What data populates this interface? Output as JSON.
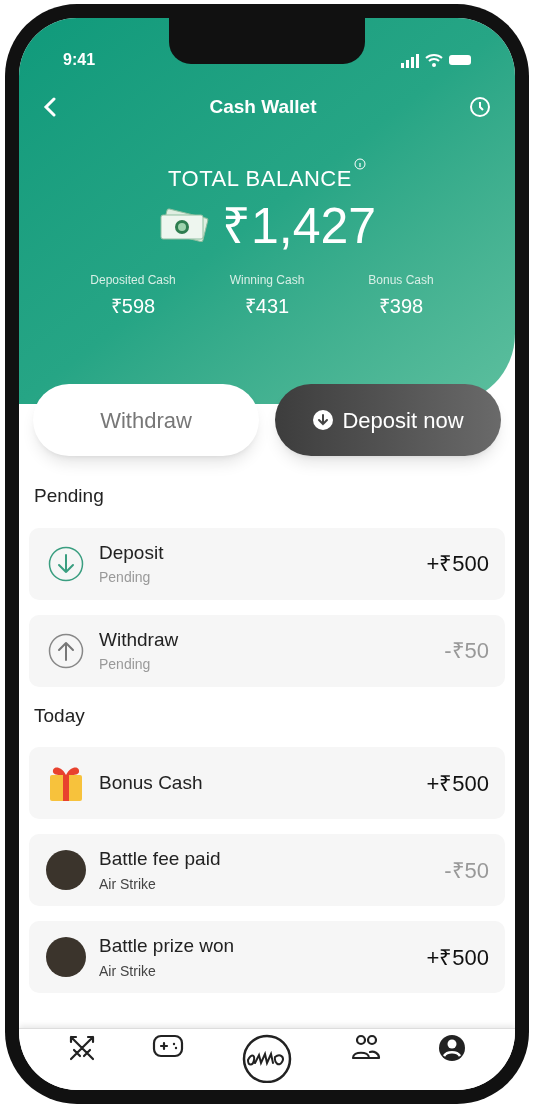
{
  "status_bar": {
    "time": "9:41"
  },
  "header": {
    "title": "Cash Wallet"
  },
  "balance": {
    "label": "TOTAL BALANCE",
    "amount": "₹1,427",
    "breakdown": [
      {
        "label": "Deposited Cash",
        "value": "₹598"
      },
      {
        "label": "Winning Cash",
        "value": "₹431"
      },
      {
        "label": "Bonus Cash",
        "value": "₹398"
      }
    ]
  },
  "actions": [
    {
      "label": "Withdraw",
      "kind": "secondary"
    },
    {
      "label": "Deposit now",
      "kind": "primary"
    }
  ],
  "sections": [
    {
      "title": "Pending",
      "items": [
        {
          "title": "Deposit",
          "subtitle": "Pending",
          "amount": "+₹500",
          "kind": "deposit",
          "muted": false
        },
        {
          "title": "Withdraw",
          "subtitle": "Pending",
          "amount": "-₹50",
          "kind": "withdrawal",
          "muted": true
        }
      ]
    },
    {
      "title": "Today",
      "items": [
        {
          "title": "Bonus Cash",
          "amount": "+₹500",
          "kind": "bonus",
          "muted": false
        },
        {
          "title": "Battle fee paid",
          "subtitle": "Air Strike",
          "amount": "-₹50",
          "kind": "battle",
          "muted": true
        },
        {
          "title": "Battle prize won",
          "subtitle": "Air Strike",
          "amount": "+₹500",
          "kind": "battle",
          "muted": false
        }
      ]
    }
  ],
  "nav": [
    {
      "kind": "battles"
    },
    {
      "kind": "games"
    },
    {
      "kind": "home"
    },
    {
      "kind": "friends"
    },
    {
      "kind": "profile"
    }
  ]
}
